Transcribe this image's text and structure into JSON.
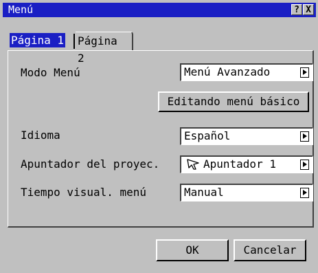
{
  "window": {
    "title": "Menú",
    "help_icon": "?",
    "close_icon": "X"
  },
  "tabs": [
    {
      "label": "Página 1",
      "selected": true
    },
    {
      "label": "Página 2",
      "selected": false
    }
  ],
  "settings": {
    "menu_mode": {
      "label": "Modo Menú",
      "value": "Menú Avanzado"
    },
    "edit_basic_menu_button": "Editando menú básico",
    "language": {
      "label": "Idioma",
      "value": "Español"
    },
    "projector_pointer": {
      "label": "Apuntador del proyec.",
      "value": "Apuntador 1",
      "icon": "pointer-arrow-icon"
    },
    "menu_display_time": {
      "label": "Tiempo visual. menú",
      "value": "Manual"
    }
  },
  "footer": {
    "ok_label": "OK",
    "cancel_label": "Cancelar"
  }
}
